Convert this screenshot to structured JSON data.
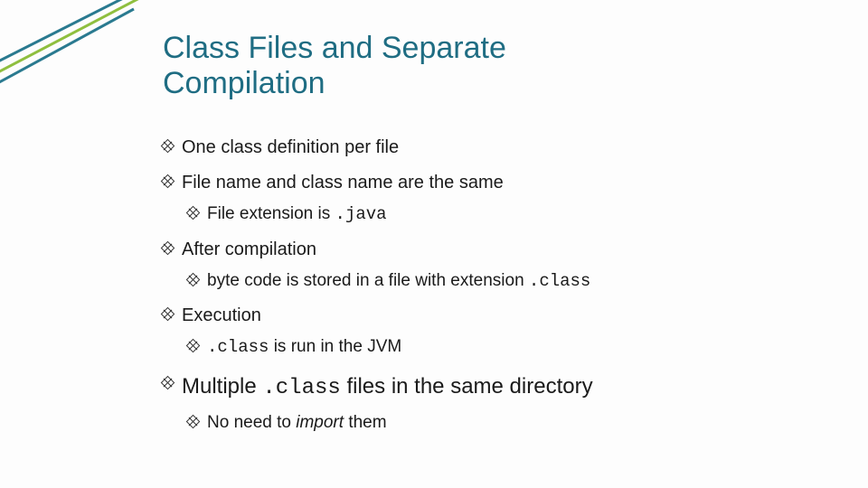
{
  "title": "Class Files and Separate Compilation",
  "bullets": {
    "b1": "One class definition per file",
    "b2": "File name and class name are the same",
    "b2a_pre": "File extension is ",
    "b2a_code": ".java",
    "b3": "After compilation",
    "b3a_pre": "byte code is stored in a file with extension ",
    "b3a_code": ".class",
    "b4": "Execution",
    "b4a_code": ".class",
    "b4a_post": " is run in the JVM",
    "b5_pre": "Multiple ",
    "b5_code": ".class",
    "b5_post": " files in the same directory",
    "b5a_pre": "No need to ",
    "b5a_ital": "import",
    "b5a_post": " them"
  },
  "colors": {
    "title": "#1f6d83",
    "deco_outer": "#2a7a90",
    "deco_inner": "#8fbf3f"
  }
}
